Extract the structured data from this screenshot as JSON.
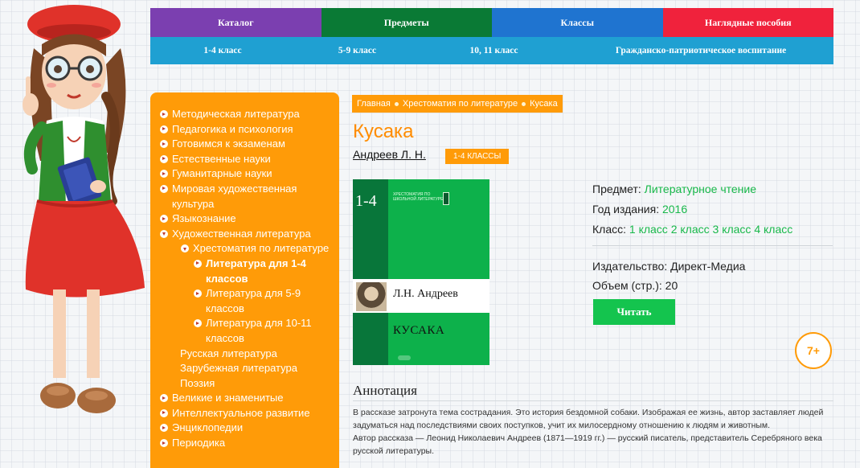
{
  "nav": {
    "row1": [
      {
        "label": "Каталог",
        "color": "#7b3fb0"
      },
      {
        "label": "Предметы",
        "color": "#0a7a35"
      },
      {
        "label": "Классы",
        "color": "#1f74d0"
      },
      {
        "label": "Наглядные пособия",
        "color": "#f0223c"
      }
    ],
    "row2": [
      "1-4 класс",
      "5-9 класс",
      "10, 11 класс",
      "Гражданско-патриотическое воспитание"
    ]
  },
  "sidebar": {
    "items": [
      "Методическая литература",
      "Педагогика и психология",
      "Готовимся к экзаменам",
      "Естественные науки",
      "Гуманитарные науки",
      "Мировая художественная культура",
      "Языкознание",
      "Художественная литература",
      "Хрестоматия по литературе",
      "Литература для 1-4 классов",
      "Литература для 5-9 классов",
      "Литература для 10-11 классов",
      "Русская литература",
      "Зарубежная литература",
      "Поэзия",
      "Великие и знаменитые",
      "Интеллектуальное развитие",
      "Энциклопедии",
      "Периодика"
    ]
  },
  "breadcrumb": [
    "Главная",
    "Хрестоматия по литературе",
    "Кусака"
  ],
  "book": {
    "title": "Кусака",
    "author": "Андреев Л. Н.",
    "grade_badge": "1-4 КЛАССЫ",
    "cover": {
      "grade": "1-4",
      "series": "Хрестоматия по школьной литературе",
      "author": "Л.Н. Андреев",
      "title": "КУСАКА"
    },
    "subject_label": "Предмет:",
    "subject_value": "Литературное чтение",
    "year_label": "Год издания:",
    "year_value": "2016",
    "class_label": "Класс:",
    "class_values": [
      "1 класс",
      "2 класс",
      "3 класс",
      "4 класс"
    ],
    "publisher": "Издательство: Директ-Медиа",
    "pages": "Объем (стр.): 20",
    "read_button": "Читать",
    "age_rating": "7+"
  },
  "annotation": {
    "heading": "Аннотация",
    "paragraph1": "В рассказе затронута тема сострадания. Это история бездомной собаки. Изображая ее жизнь, автор заставляет людей задуматься над последствиями своих поступков, учит их милосердному отношению к людям и животным.",
    "paragraph2": "Автор рассказа — Леонид Николаевич Андреев (1871—1919 гг.) — русский писатель, представитель Серебряного века русской литературы."
  },
  "colors": {
    "accent_orange": "#ff9b08",
    "link_green": "#18b84a",
    "nav_blue": "#1fa0d2"
  }
}
